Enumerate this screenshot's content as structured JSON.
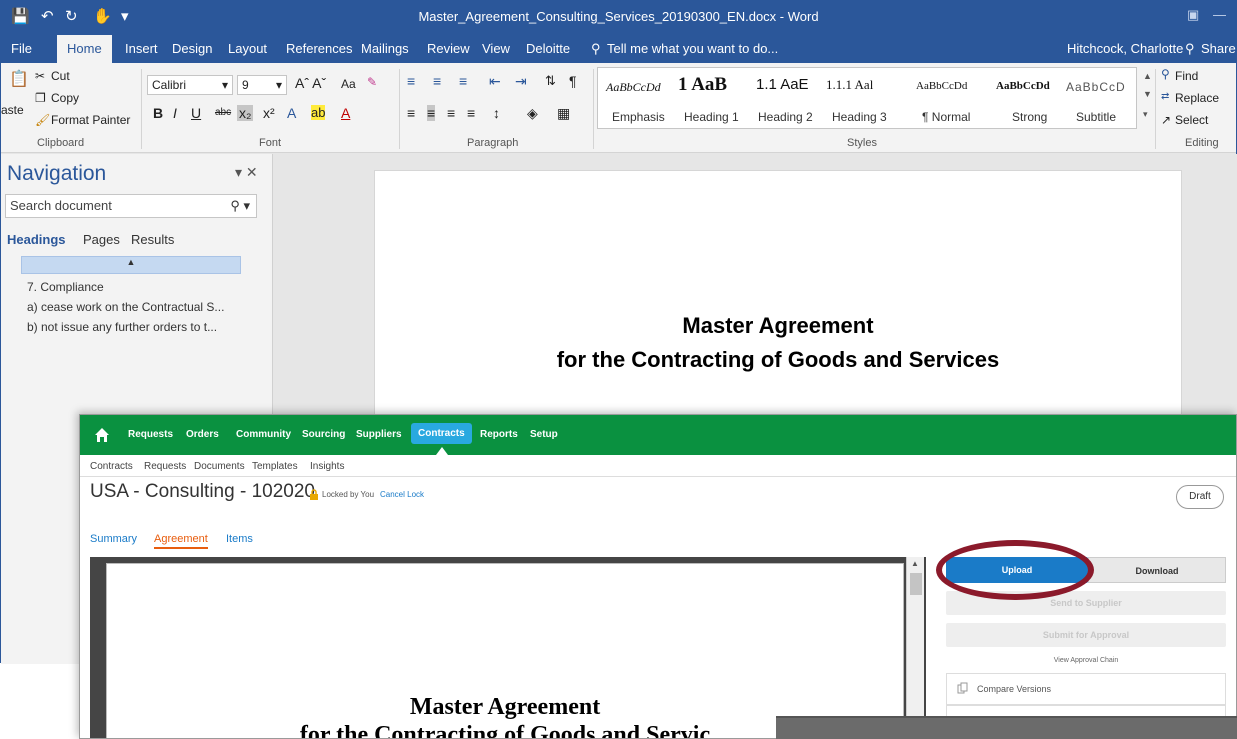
{
  "word": {
    "title": "Master_Agreement_Consulting_Services_20190300_EN.docx - Word",
    "user": "Hitchcock, Charlotte",
    "share_label": "Share",
    "tabs": [
      "File",
      "Home",
      "Insert",
      "Design",
      "Layout",
      "References",
      "Mailings",
      "Review",
      "View",
      "Deloitte"
    ],
    "tell_me": "Tell me what you want to do...",
    "clipboard": {
      "cut": "Cut",
      "copy": "Copy",
      "paste": "aste",
      "format_painter": "Format Painter",
      "group": "Clipboard"
    },
    "font": {
      "name": "Calibri",
      "size": "9",
      "group": "Font",
      "case": "Aa"
    },
    "paragraph": {
      "group": "Paragraph"
    },
    "styles": {
      "group": "Styles",
      "items": [
        {
          "preview": "AaBbCcDd",
          "name": "Emphasis"
        },
        {
          "preview": "1 AaB",
          "name": "Heading 1"
        },
        {
          "preview": "1.1 AaE",
          "name": "Heading 2"
        },
        {
          "preview": "1.1.1 Aal",
          "name": "Heading 3"
        },
        {
          "preview": "AaBbCcDd",
          "name": "¶ Normal"
        },
        {
          "preview": "AaBbCcDd",
          "name": "Strong"
        },
        {
          "preview": "AaBbCcD",
          "name": "Subtitle"
        }
      ]
    },
    "editing": {
      "find": "Find",
      "replace": "Replace",
      "select": "Select",
      "group": "Editing"
    },
    "navigation": {
      "title": "Navigation",
      "search_placeholder": "Search document",
      "tabs": [
        "Headings",
        "Pages",
        "Results"
      ],
      "headings": [
        "7. Compliance",
        "a) cease work on the Contractual S...",
        "b) not issue any further orders to t..."
      ]
    },
    "page_title_line1": "Master Agreement",
    "page_title_line2": "for the Contracting of Goods and Services"
  },
  "app": {
    "nav": [
      "Requests",
      "Orders",
      "Community",
      "Sourcing",
      "Suppliers",
      "Contracts",
      "Reports",
      "Setup"
    ],
    "active_nav": "Contracts",
    "subnav": [
      "Contracts",
      "Requests",
      "Documents",
      "Templates",
      "Insights"
    ],
    "title": "USA - Consulting - 102020",
    "lock_text": "Locked by You",
    "cancel_lock": "Cancel Lock",
    "status": "Draft",
    "tabs": [
      "Summary",
      "Agreement",
      "Items"
    ],
    "active_tab": "Agreement",
    "doc_title_line1": "Master Agreement",
    "doc_title_line2": "for the Contracting of Goods and Servic",
    "upload": "Upload",
    "download": "Download",
    "send_to_supplier": "Send to Supplier",
    "submit_for_approval": "Submit for Approval",
    "view_approval_chain": "View Approval Chain",
    "compare_versions": "Compare Versions",
    "accent_color": "#0a9140",
    "highlight_color": "#8b1a2b"
  }
}
